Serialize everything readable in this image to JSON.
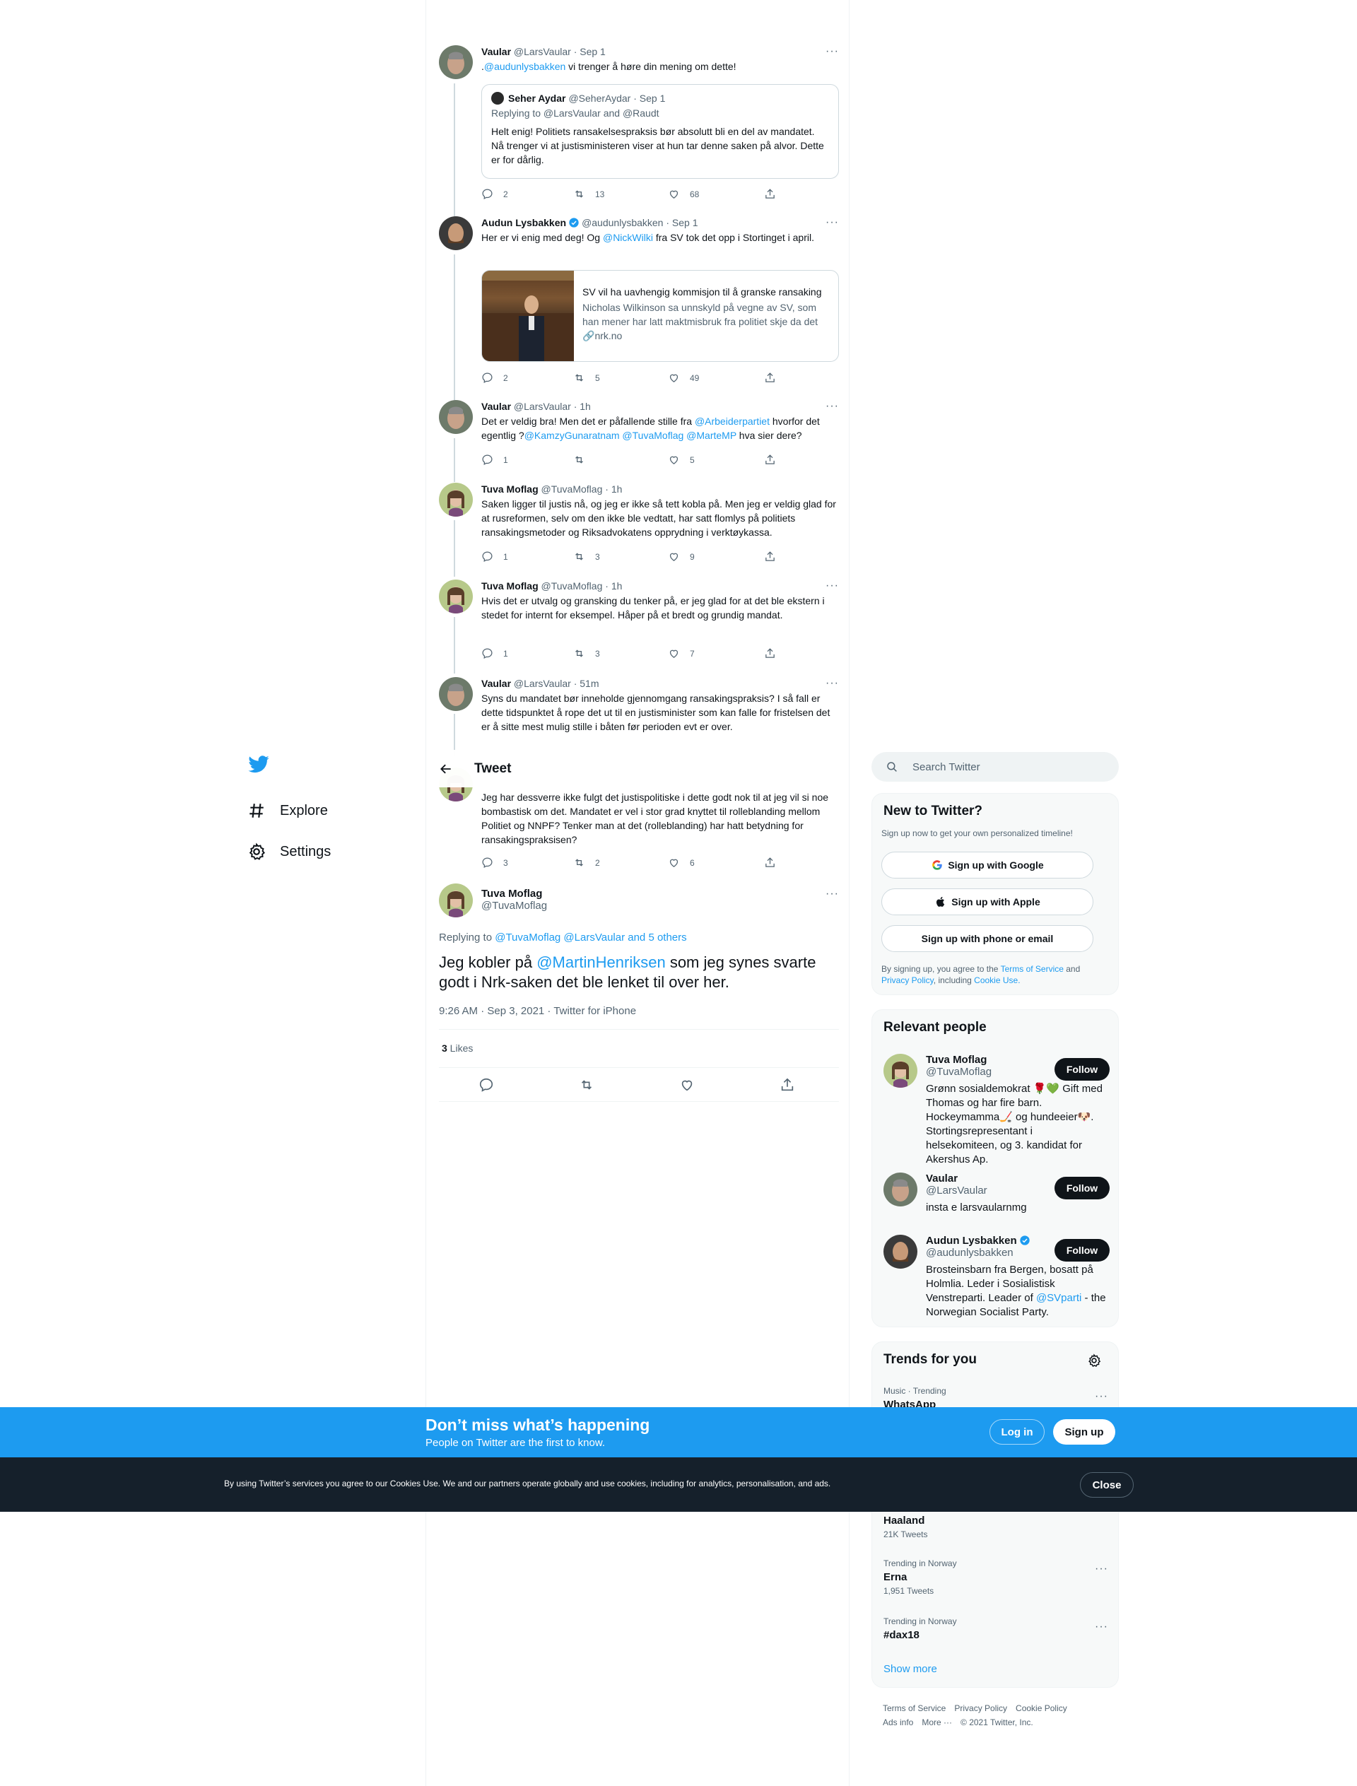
{
  "nav": {
    "items": [
      {
        "label": "Explore",
        "icon": "hashtag-icon"
      },
      {
        "label": "Settings",
        "icon": "gear-icon"
      }
    ]
  },
  "header": {
    "title": "Tweet"
  },
  "thread": [
    {
      "name": "Vaular",
      "handle": "@LarsVaular",
      "time": "· Sep 1",
      "text_prefix": ".",
      "mention": "@audunlysbakken",
      "text_suffix": " vi trenger å høre din mening om dette!",
      "quote": {
        "name": "Seher Aydar",
        "handle": "@SeherAydar",
        "time": "· Sep 1",
        "replying": "Replying to @LarsVaular and @Raudt",
        "text": "Helt enig! Politiets ransakelsespraksis bør absolutt bli en del av mandatet. Nå trenger vi at justisministeren viser at hun tar denne saken på alvor. Dette er for dårlig."
      },
      "replies": "2",
      "retweets": "13",
      "likes": "68"
    },
    {
      "name": "Audun Lysbakken",
      "handle": "@audunlysbakken",
      "time": "· Sep 1",
      "text_a": "Her er vi enig med deg! Og ",
      "mention": "@NickWilki",
      "text_b": " fra SV tok det opp i Stortinget i april.",
      "card": {
        "title": "SV vil ha uavhengig kommisjon til å granske ransaking",
        "desc": "Nicholas Wilkinson sa unnskyld på vegne av SV, som han mener har latt maktmisbruk fra politiet skje da det kom til ransakinger.",
        "domain": "nrk.no"
      },
      "replies": "2",
      "retweets": "5",
      "likes": "49"
    },
    {
      "name": "Vaular",
      "handle": "@LarsVaular",
      "time": "· 1h",
      "text_a": "Det er veldig bra! Men det er påfallende stille fra ",
      "mention_a": "@Arbeiderpartiet",
      "text_b": " hvorfor det egentlig ?",
      "mention_b": "@KamzyGunaratnam @TuvaMoflag @MarteMP",
      "text_c": " hva sier dere?",
      "replies": "1",
      "retweets": "",
      "likes": "5"
    },
    {
      "name": "Tuva Moflag",
      "handle": "@TuvaMoflag",
      "time": "· 1h",
      "text": "Saken ligger til justis nå, og jeg er ikke så tett kobla på. Men jeg er veldig glad for at rusreformen, selv om den ikke ble vedtatt, har satt flomlys på politiets ransakingsmetoder og Riksadvokatens opprydning i verktøykassa.",
      "replies": "1",
      "retweets": "3",
      "likes": "9"
    },
    {
      "name": "Tuva Moflag",
      "handle": "@TuvaMoflag",
      "time": "· 1h",
      "text": "Hvis det er utvalg og gransking du tenker på, er jeg glad for at det ble ekstern i stedet for internt for eksempel. Håper på et bredt og grundig mandat.",
      "replies": "1",
      "retweets": "3",
      "likes": "7"
    },
    {
      "name": "Vaular",
      "handle": "@LarsVaular",
      "time": "· 51m",
      "text": "Syns du mandatet bør inneholde gjennomgang ransakingspraksis? I så fall er dette tidspunktet å rope det ut til en justisminister som kan falle for fristelsen det er å sitte mest mulig stille i båten før perioden evt er over."
    },
    {
      "text": "Jeg har dessverre ikke fulgt det justispolitiske i dette godt nok til at jeg vil si noe bombastisk om det. Mandatet er vel i stor grad knyttet til rolleblanding mellom Politiet og NNPF?  Tenker man at det (rolleblanding) har hatt betydning for ransakingspraksisen?",
      "replies": "3",
      "retweets": "2",
      "likes": "6"
    }
  ],
  "main_tweet": {
    "name": "Tuva Moflag",
    "handle": "@TuvaMoflag",
    "replying_label": "Replying to ",
    "replying_to": "@TuvaMoflag @LarsVaular and 5 others",
    "text_a": "Jeg kobler på ",
    "mention": "@MartinHenriksen",
    "text_b": " som jeg synes svarte godt i Nrk-saken det ble lenket til over her.",
    "meta": "9:26 AM · Sep 3, 2021 · Twitter for iPhone",
    "likes_count": "3",
    "likes_label": " Likes"
  },
  "sidebar": {
    "search_placeholder": "Search Twitter",
    "new_title": "New to Twitter?",
    "new_sub": "Sign up now to get your own personalized timeline!",
    "google_btn": "Sign up with Google",
    "apple_btn": "Sign up with Apple",
    "phone_btn": "Sign up with phone or email",
    "legal_a": "By signing up, you agree to the ",
    "legal_terms": "Terms of Service",
    "legal_b": " and ",
    "legal_privacy": "Privacy Policy",
    "legal_c": ", including ",
    "legal_cookie": "Cookie Use.",
    "people_title": "Relevant people",
    "people": [
      {
        "name": "Tuva Moflag",
        "handle": "@TuvaMoflag",
        "bio": "Grønn sosialdemokrat 🌹💚 Gift med Thomas og har fire barn. Hockeymamma🏒 og hundeeier🐶. Stortingsrepresentant i helsekomiteen, og 3. kandidat for Akershus Ap.",
        "follow": "Follow"
      },
      {
        "name": "Vaular",
        "handle": "@LarsVaular",
        "bio": "insta e larsvaularnmg",
        "follow": "Follow"
      },
      {
        "name": "Audun Lysbakken",
        "handle": "@audunlysbakken",
        "bio_a": "Brosteinsbarn fra Bergen, bosatt på Holmlia. Leder i Sosialistisk Venstreparti. Leader of ",
        "bio_mention": "@SVparti",
        "bio_b": " - the Norwegian Socialist Party.",
        "follow": "Follow"
      }
    ],
    "trends_title": "Trends for you",
    "trends": [
      {
        "meta": "Music · Trending",
        "name": "WhatsApp",
        "count": ""
      },
      {
        "meta": "",
        "name": "Haaland",
        "count": "21K Tweets"
      },
      {
        "meta": "Trending in Norway",
        "name": "Erna",
        "count": "1,951 Tweets"
      },
      {
        "meta": "Trending in Norway",
        "name": "#dax18",
        "count": ""
      }
    ],
    "show_more": "Show more"
  },
  "footer": {
    "links": [
      "Terms of Service",
      "Privacy Policy",
      "Cookie Policy",
      "Ads info",
      "More ···",
      "© 2021 Twitter, Inc."
    ]
  },
  "banner": {
    "title": "Don’t miss what’s happening",
    "subtitle": "People on Twitter are the first to know.",
    "login": "Log in",
    "signup": "Sign up"
  },
  "cookie": {
    "text": "By using Twitter’s services you agree to our Cookies Use. We and our partners operate globally and use cookies, including for analytics, personalisation, and ads.",
    "close": "Close"
  },
  "colors": {
    "accent": "#1d9bf0",
    "dark": "#0f1419",
    "muted": "#536471",
    "cookie_bg": "#15202b"
  }
}
